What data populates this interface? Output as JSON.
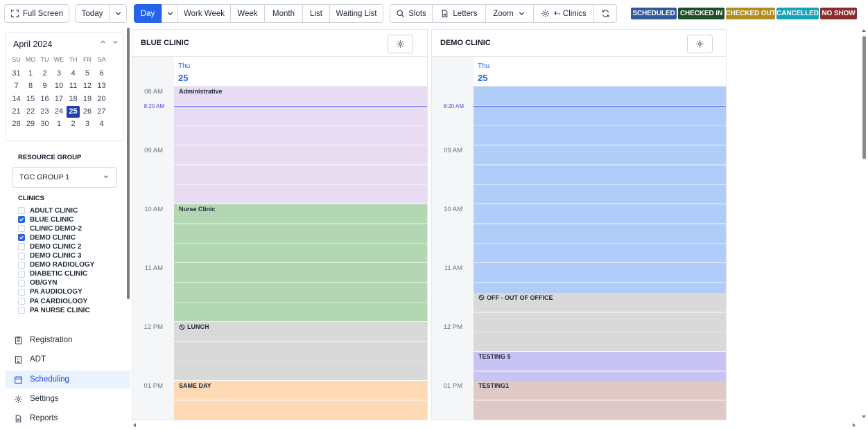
{
  "toolbar": {
    "full_screen": "Full Screen",
    "today": "Today",
    "day": "Day",
    "work_week": "Work Week",
    "week": "Week",
    "month": "Month",
    "list": "List",
    "waiting_list": "Waiting List",
    "slots": "Slots",
    "letters": "Letters",
    "zoom": "Zoom",
    "clinics": "+- Clinics"
  },
  "legend": [
    {
      "label": "SCHEDULED",
      "color": "#2f5a9e"
    },
    {
      "label": "CHECKED IN",
      "color": "#1f4d2a"
    },
    {
      "label": "CHECKED OUT",
      "color": "#b08d1c"
    },
    {
      "label": "CANCELLED",
      "color": "#17a2b8"
    },
    {
      "label": "NO SHOW",
      "color": "#8b2c2c"
    }
  ],
  "mini_calendar": {
    "title": "April 2024",
    "weekdays": [
      "SU",
      "MO",
      "TU",
      "WE",
      "TH",
      "FR",
      "SA"
    ],
    "weeks": [
      [
        "31",
        "1",
        "2",
        "3",
        "4",
        "5",
        "6"
      ],
      [
        "7",
        "8",
        "9",
        "10",
        "11",
        "12",
        "13"
      ],
      [
        "14",
        "15",
        "16",
        "17",
        "18",
        "19",
        "20"
      ],
      [
        "21",
        "22",
        "23",
        "24",
        "25",
        "26",
        "27"
      ],
      [
        "28",
        "29",
        "30",
        "1",
        "2",
        "3",
        "4"
      ]
    ],
    "selected": "25"
  },
  "resource_group": {
    "label": "RESOURCE GROUP",
    "value": "TGC GROUP 1"
  },
  "clinics": {
    "label": "CLINICS",
    "items": [
      {
        "name": "ADULT CLINIC",
        "checked": false
      },
      {
        "name": "BLUE CLINIC",
        "checked": true
      },
      {
        "name": "CLINIC DEMO-2",
        "checked": false
      },
      {
        "name": "DEMO CLINIC",
        "checked": true
      },
      {
        "name": "DEMO CLINIC 2",
        "checked": false
      },
      {
        "name": "DEMO CLINIC 3",
        "checked": false
      },
      {
        "name": "DEMO RADIOLOGY",
        "checked": false
      },
      {
        "name": "DIABETIC CLINIC",
        "checked": false
      },
      {
        "name": "OB/GYN",
        "checked": false
      },
      {
        "name": "PA AUDIOLOGY",
        "checked": false
      },
      {
        "name": "PA CARDIOLOGY",
        "checked": false
      },
      {
        "name": "PA NURSE CLINIC",
        "checked": false
      }
    ]
  },
  "nav": {
    "registration": "Registration",
    "adt": "ADT",
    "scheduling": "Scheduling",
    "settings": "Settings",
    "reports": "Reports"
  },
  "panels": [
    {
      "title": "BLUE CLINIC",
      "day_of_week": "Thu",
      "day_number": "25",
      "times": [
        "08 AM",
        "09 AM",
        "10 AM",
        "11 AM",
        "12 PM",
        "01 PM"
      ],
      "now_label": "8:20 AM",
      "blocks": [
        {
          "label": "Administrative",
          "color": "#e8dcf2"
        },
        {
          "label": "Nurse Clinic",
          "color": "#b3d7b3"
        },
        {
          "label": "LUNCH",
          "color": "#d9d9d9"
        },
        {
          "label": "SAME DAY",
          "color": "#fdd9b5"
        }
      ]
    },
    {
      "title": "DEMO CLINIC",
      "day_of_week": "Thu",
      "day_number": "25",
      "times": [
        "09 AM",
        "10 AM",
        "11 AM",
        "12 PM",
        "01 PM"
      ],
      "now_label": "8:20 AM",
      "blocks": [
        {
          "label": "",
          "color": "#b0cdfa"
        },
        {
          "label": "OFF - OUT OF OFFICE",
          "color": "#d9d9d9"
        },
        {
          "label": "TESTING 5",
          "color": "#c7c4f3"
        },
        {
          "label": "TESTING1",
          "color": "#dfc9c6"
        }
      ]
    }
  ]
}
